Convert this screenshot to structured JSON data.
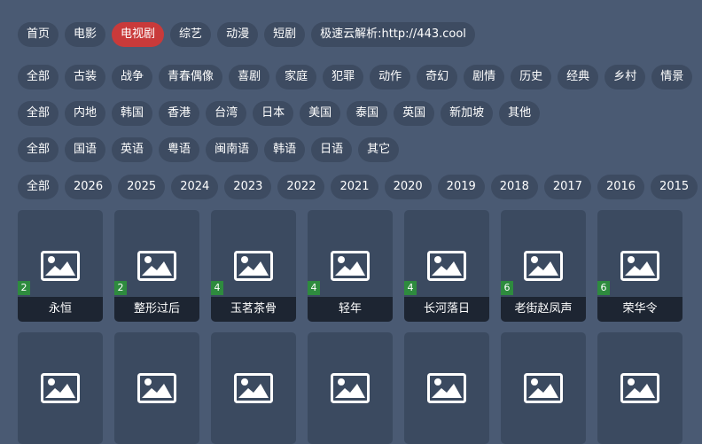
{
  "nav": {
    "items": [
      {
        "label": "首页",
        "active": false
      },
      {
        "label": "电影",
        "active": false
      },
      {
        "label": "电视剧",
        "active": true
      },
      {
        "label": "综艺",
        "active": false
      },
      {
        "label": "动漫",
        "active": false
      },
      {
        "label": "短剧",
        "active": false
      },
      {
        "label": "极速云解析:http://443.cool",
        "active": false
      }
    ]
  },
  "filters": {
    "genre": [
      "全部",
      "古装",
      "战争",
      "青春偶像",
      "喜剧",
      "家庭",
      "犯罪",
      "动作",
      "奇幻",
      "剧情",
      "历史",
      "经典",
      "乡村",
      "情景"
    ],
    "region": [
      "全部",
      "内地",
      "韩国",
      "香港",
      "台湾",
      "日本",
      "美国",
      "泰国",
      "英国",
      "新加坡",
      "其他"
    ],
    "language": [
      "全部",
      "国语",
      "英语",
      "粤语",
      "闽南语",
      "韩语",
      "日语",
      "其它"
    ],
    "year": [
      "全部",
      "2026",
      "2025",
      "2024",
      "2023",
      "2022",
      "2021",
      "2020",
      "2019",
      "2018",
      "2017",
      "2016",
      "2015"
    ]
  },
  "cards": [
    {
      "title": "永恒",
      "badge": "2"
    },
    {
      "title": "整形过后",
      "badge": "2"
    },
    {
      "title": "玉茗茶骨",
      "badge": "4"
    },
    {
      "title": "轻年",
      "badge": "4"
    },
    {
      "title": "长河落日",
      "badge": "4"
    },
    {
      "title": "老街赵凤声",
      "badge": "6"
    },
    {
      "title": "荣华令",
      "badge": "6"
    },
    {
      "title": "",
      "badge": ""
    },
    {
      "title": "",
      "badge": ""
    },
    {
      "title": "",
      "badge": ""
    },
    {
      "title": "",
      "badge": ""
    },
    {
      "title": "",
      "badge": ""
    },
    {
      "title": "",
      "badge": ""
    },
    {
      "title": "",
      "badge": ""
    }
  ],
  "colors": {
    "background": "#4a5a73",
    "chip": "#3d4b61",
    "active_chip": "#c93a3a",
    "badge": "#2e8b3e",
    "title_bar": "#1d2532"
  },
  "icons": {
    "placeholder": "image-placeholder-icon"
  }
}
